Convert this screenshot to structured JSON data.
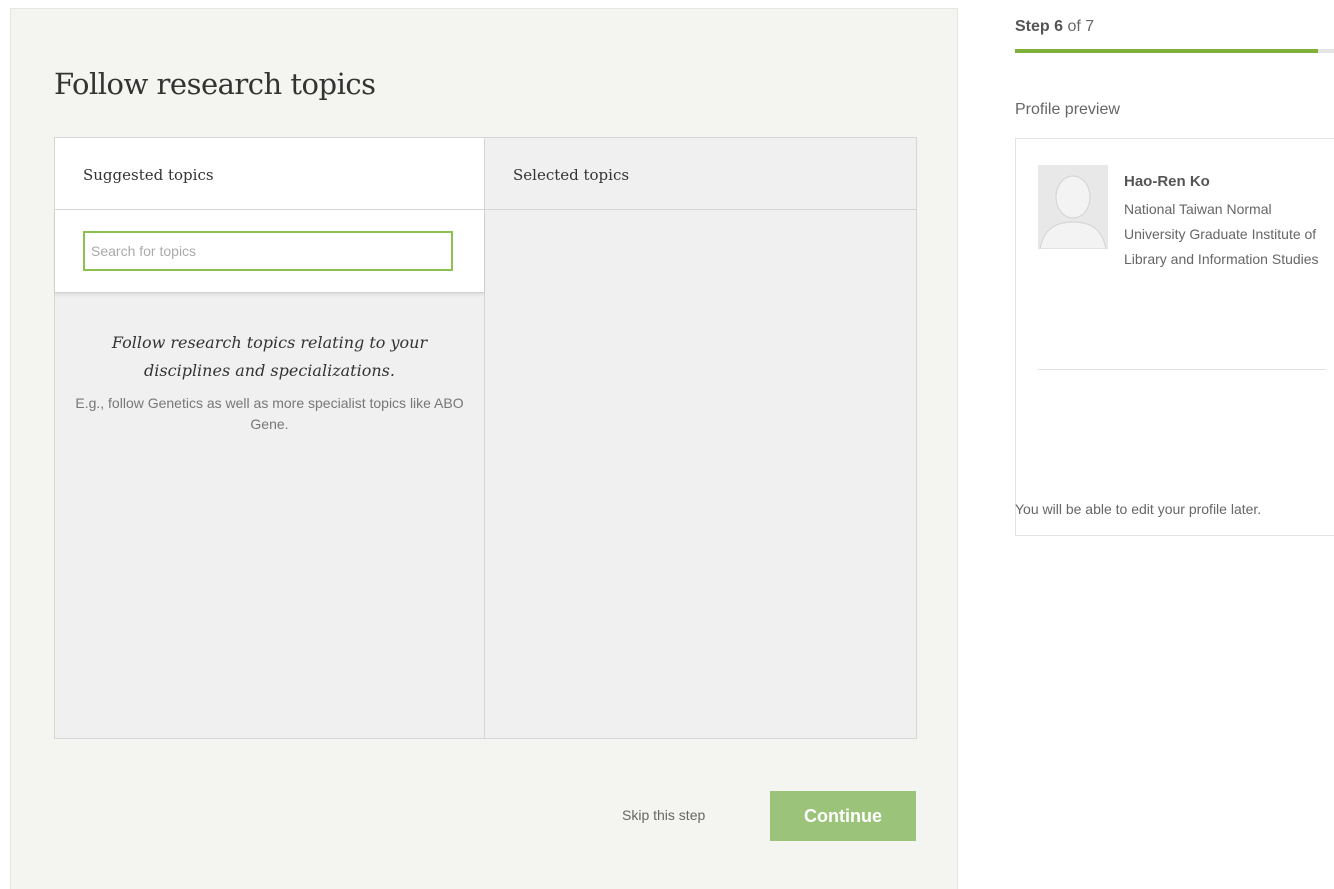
{
  "page": {
    "title": "Follow research topics"
  },
  "topics": {
    "suggested_header": "Suggested topics",
    "selected_header": "Selected topics",
    "search": {
      "placeholder": "Search for topics",
      "value": ""
    },
    "hint_main": "Follow research topics relating to your disciplines and specializations.",
    "hint_sub": "E.g., follow Genetics as well as more specialist topics like ABO Gene.",
    "selected": []
  },
  "actions": {
    "skip_label": "Skip this step",
    "continue_label": "Continue"
  },
  "progress": {
    "step_word": "Step",
    "current": "6",
    "of_word": "of",
    "total": "7",
    "fraction": 0.95
  },
  "preview": {
    "label": "Profile preview",
    "name": "Hao-Ren Ko",
    "affiliation": "National Taiwan Normal University Graduate Institute of Library and Information Studies",
    "edit_note": "You will be able to edit your profile later."
  },
  "colors": {
    "accent_green": "#7fb13a",
    "button_green": "#9bc47a",
    "input_border": "#8cc152"
  },
  "icons": {
    "avatar": "default-avatar-silhouette-icon"
  }
}
